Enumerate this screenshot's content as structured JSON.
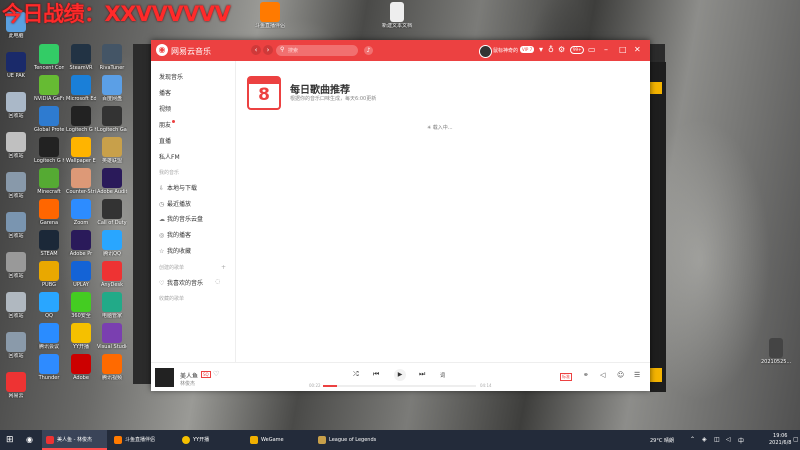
{
  "overlay_text": "今日战绩：XXVVVVVV",
  "desktop": {
    "icons_left": [
      {
        "label": "此电脑",
        "color": "#5aa0e0"
      },
      {
        "label": "UE PAK",
        "color": "#1a2a6a"
      },
      {
        "label": "回收站",
        "color": "#aab8c8"
      },
      {
        "label": "回收站",
        "color": "#c0c0c0"
      },
      {
        "label": "回收站",
        "color": "#8899aa"
      },
      {
        "label": "回收站",
        "color": "#7a95b0"
      },
      {
        "label": "回收站",
        "color": "#999"
      },
      {
        "label": "回收站",
        "color": "#b0b8c0"
      },
      {
        "label": "回收站",
        "color": "#8a9aaa"
      },
      {
        "label": "网易云",
        "color": "#e33"
      }
    ],
    "top_icons": [
      {
        "label": "斗鱼直播伴侣",
        "color": "#ff7a00"
      },
      {
        "label": "新建文本文档",
        "color": "#eee"
      }
    ],
    "grid_icons": [
      "Tencent Connected",
      "SteamVR",
      "RivaTuner",
      "NVIDIA GeForce Experience",
      "Microsoft Edge",
      "百度网盘",
      "Global Protect",
      "Logitech G HUB",
      "Logitech Gaming",
      "Logitech G HUB",
      "Wallpaper Engine",
      "英雄联盟",
      "Minecraft",
      "Counter-Strike",
      "Adobe Audition",
      "Garena",
      "Zoom",
      "Call of Duty",
      "STEAM",
      "Adobe Pr",
      "腾讯QQ",
      "PUBG",
      "UPLAY",
      "AnyDesk",
      "QQ",
      "360安全",
      "电脑管家",
      "腾讯会议",
      "YY开播",
      "Visual Studio",
      "Thunder",
      "Adobe",
      "腾讯视频"
    ],
    "right_icon_label": "20210525..."
  },
  "app": {
    "name": "网易云音乐",
    "search_placeholder": "搜索",
    "username": "鼠标神奇的",
    "vip": "VIP 7",
    "msg_badge": "99+",
    "sidebar": {
      "main": [
        {
          "label": "发现音乐"
        },
        {
          "label": "播客"
        },
        {
          "label": "视频"
        },
        {
          "label": "朋友"
        },
        {
          "label": "直播"
        },
        {
          "label": "私人FM"
        }
      ],
      "my_music_title": "我的音乐",
      "my_music": [
        {
          "label": "本地与下载",
          "icon": "⇩"
        },
        {
          "label": "最近播放",
          "icon": "◷"
        },
        {
          "label": "我的音乐云盘",
          "icon": "☁"
        },
        {
          "label": "我的播客",
          "icon": "◎"
        },
        {
          "label": "我的收藏",
          "icon": "☆"
        }
      ],
      "created_title": "创建的歌单",
      "liked": "我喜欢的音乐",
      "collected_title": "收藏的歌单"
    },
    "daily": {
      "day": "8",
      "title": "每日歌曲推荐",
      "subtitle": "根据你的音乐口味生成，每天6:00更新"
    },
    "loading": "载入中..."
  },
  "player": {
    "song": "美人鱼",
    "quality_tag": "SQ",
    "artist": "林俊杰",
    "current": "00:22",
    "total": "04:14",
    "progress": 0.09,
    "quality": "标准",
    "accent": "#ec4141"
  },
  "taskbar": {
    "items": [
      {
        "label": "美人鱼 - 林俊杰",
        "color": "#e33"
      },
      {
        "label": "斗鱼直播伴侣",
        "color": "#ff7a00"
      },
      {
        "label": "YY开播",
        "color": "#f5c000"
      },
      {
        "label": "WeGame",
        "color": "#f0b000"
      },
      {
        "label": "League of Legends",
        "color": "#c8a04a"
      }
    ],
    "weather": "29°C 晴朗",
    "time": "19:06",
    "date": "2021/6/8"
  }
}
